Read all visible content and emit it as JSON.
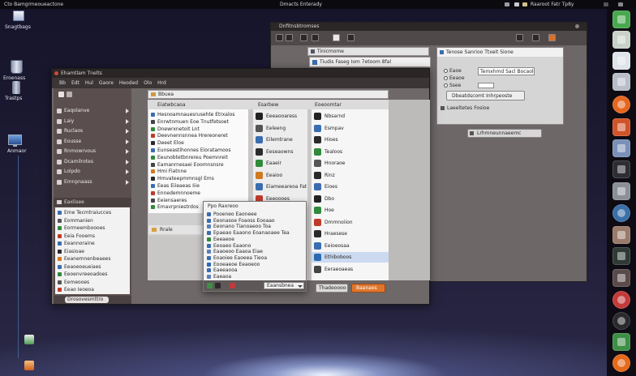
{
  "top_panel": {
    "left_title": "Cto Bamgrmeoueactone",
    "center_title": "Dmacts Enterady",
    "status_text": "Raaroot Fatr Tp8y"
  },
  "desktop": {
    "icons": [
      {
        "label": "Snagtbags",
        "icon": "document-stack-icon"
      },
      {
        "label": "Eroenass",
        "icon": "trash-icon"
      },
      {
        "label": "Trastps",
        "icon": "bin-icon"
      },
      {
        "label": "Anmaor",
        "icon": "monitor-icon"
      }
    ]
  },
  "dock": {
    "items": [
      {
        "icon": "chat-icon",
        "color": "#48a84e",
        "shape": "square"
      },
      {
        "icon": "phone-icon",
        "color": "#c9d2c8",
        "shape": "square"
      },
      {
        "icon": "grid-icon",
        "color": "#dfe4ea",
        "shape": "square"
      },
      {
        "icon": "document-icon",
        "color": "#b8bec8",
        "shape": "square"
      },
      {
        "icon": "media-player-icon",
        "color": "#e4661f",
        "shape": "round"
      },
      {
        "icon": "app-icon",
        "color": "#d0542a",
        "shape": "square"
      },
      {
        "icon": "image-icon",
        "color": "#7a90b8",
        "shape": "square"
      },
      {
        "icon": "terminal-icon",
        "color": "#2d2d33",
        "shape": "square"
      },
      {
        "icon": "photo-icon",
        "color": "#8a8f98",
        "shape": "square"
      },
      {
        "icon": "globe-icon",
        "color": "#3b6fa8",
        "shape": "round"
      },
      {
        "icon": "picture-icon",
        "color": "#9a7a6a",
        "shape": "square"
      },
      {
        "icon": "monitor-icon",
        "color": "#2f3a36",
        "shape": "square"
      },
      {
        "icon": "flag-icon",
        "color": "#5a4a4a",
        "shape": "square"
      },
      {
        "icon": "close-app-icon",
        "color": "#c23a3a",
        "shape": "round"
      },
      {
        "icon": "clock-icon",
        "color": "#2a2a2e",
        "shape": "round"
      },
      {
        "icon": "download-icon",
        "color": "#3e8f46",
        "shape": "square"
      },
      {
        "icon": "browser-icon",
        "color": "#e46a1a",
        "shape": "round"
      }
    ]
  },
  "back_window": {
    "title": "Dnfitnsbtromses",
    "bar_top": "Tinicmome",
    "bar_field": "Tiudis Faseg Iom 7etoom 8fal",
    "dialog": {
      "title": "Tenose Sanrioo Ttxeit Sione",
      "options": [
        "Eaoe",
        "Eeaoe",
        "Ssee"
      ],
      "text_value": "Temxhmd Sacl Bocaolet",
      "action_button": "Dbeatdscomt Inhrpeoste",
      "footer_text": "Laeeltetes Fosioe"
    },
    "bottom_button": "Lrhmneunnaeemc",
    "accent_color": "#e0762c"
  },
  "file_manager": {
    "title": "Ehamtlam Tnelts",
    "menu": [
      "Bb",
      "Edt",
      "Hul",
      "Gaore",
      "Heoded",
      "Olo",
      "Hrd"
    ],
    "sidebar": {
      "places": [
        {
          "label": "Eaqolanve",
          "icon": "folder-icon"
        },
        {
          "label": "Laiy",
          "icon": "folder-icon"
        },
        {
          "label": "Ruclaos",
          "icon": "folder-icon"
        },
        {
          "label": "Eousse",
          "icon": "folder-icon"
        },
        {
          "label": "Rnmowrvous",
          "icon": "folder-icon"
        },
        {
          "label": "Dcamilrotes",
          "icon": "folder-icon"
        },
        {
          "label": "Lolpdo",
          "icon": "folder-icon"
        },
        {
          "label": "Emnpnaass",
          "icon": "folder-icon"
        }
      ],
      "section": "Eaxlisee",
      "list": [
        {
          "label": "Eme Tecmtraiucces",
          "icon": "file-icon",
          "color": "#3a6db0"
        },
        {
          "label": "Eommanien",
          "icon": "file-icon",
          "color": "#555555"
        },
        {
          "label": "Eormeemboooes",
          "icon": "file-icon",
          "color": "#2f8a3a"
        },
        {
          "label": "Eeia Fooems",
          "icon": "file-icon",
          "color": "#c03a2a"
        },
        {
          "label": "Eeannoraine",
          "icon": "file-icon",
          "color": "#3a6db0"
        },
        {
          "label": "Eiasioae",
          "icon": "file-icon",
          "color": "#2a2a2a"
        },
        {
          "label": "Eeanemnenbeaees",
          "icon": "file-icon",
          "color": "#d07a20"
        },
        {
          "label": "Eeaoeoeueiaes",
          "icon": "file-icon",
          "color": "#3a6db0"
        },
        {
          "label": "Eeoenvreeoadoes",
          "icon": "file-icon",
          "color": "#2f8a3a"
        },
        {
          "label": "Eemeooes",
          "icon": "file-icon",
          "color": "#555555"
        },
        {
          "label": "Eeao Ieoeoa",
          "icon": "file-icon",
          "color": "#c03a2a"
        }
      ],
      "status": "Drosovesmttro"
    },
    "location": "Bbuea",
    "columns": [
      {
        "header": "Eiatwbcaoa",
        "items": [
          {
            "label": "Hesnoamnauesrusehte Etrxalos",
            "icon": "file-icon",
            "color": "#3a6db0"
          },
          {
            "label": "Enrwtnmuen Eoe Tnutfetsoet",
            "icon": "file-icon",
            "color": "#444444"
          },
          {
            "label": "Dnewrxnetoit Lnt",
            "icon": "file-icon",
            "color": "#2f8a3a"
          },
          {
            "label": "Deevnennsnnea Hrereoneret",
            "icon": "file-icon",
            "color": "#c03a2a"
          },
          {
            "label": "Deeet Eloe",
            "icon": "file-icon",
            "color": "#2a2a2a"
          },
          {
            "label": "Eunseastihonnes Eioratamoos",
            "icon": "file-icon",
            "color": "#3a6db0"
          },
          {
            "label": "Eeunobtetbnrereu Poemnreit",
            "icon": "file-icon",
            "color": "#2f8a3a"
          },
          {
            "label": "Eamanrnesaei Eoomnsnsre",
            "icon": "file-icon",
            "color": "#444444"
          },
          {
            "label": "Hmi Fiatnne",
            "icon": "file-icon",
            "color": "#d07a20"
          },
          {
            "label": "Hmvateepmmnsgl Ems",
            "icon": "file-icon",
            "color": "#2a2a2a"
          },
          {
            "label": "Eeas Eiieaeas Iiie",
            "icon": "file-icon",
            "color": "#3a6db0"
          },
          {
            "label": "Ennedemnnoeme",
            "icon": "file-icon",
            "color": "#c03a2a"
          },
          {
            "label": "Eeiensaeres",
            "icon": "file-icon",
            "color": "#444444"
          },
          {
            "label": "Emavrpniestrdos",
            "icon": "file-icon",
            "color": "#2f8a3a"
          }
        ]
      },
      {
        "header": "Esarbew",
        "items": [
          {
            "label": "Eeeaooaress",
            "icon": "app-icon",
            "color": "#222222"
          },
          {
            "label": "Eeleeng",
            "icon": "app-icon",
            "color": "#555555"
          },
          {
            "label": "Eilemtrane",
            "icon": "app-icon",
            "color": "#3a6db0"
          },
          {
            "label": "Eeseaowns",
            "icon": "app-icon",
            "color": "#2a2a2a"
          },
          {
            "label": "Eaaeir",
            "icon": "app-icon",
            "color": "#2f8a3a"
          },
          {
            "label": "Eeaioo",
            "icon": "app-icon",
            "color": "#d07a20"
          },
          {
            "label": "Eiameeareoa Fat",
            "icon": "app-icon",
            "color": "#3a6db0"
          },
          {
            "label": "Eeeoooes",
            "icon": "app-icon",
            "color": "#c03a2a"
          }
        ]
      },
      {
        "header": "Eoeoomtar",
        "selected_index": 12,
        "items": [
          {
            "label": "Nbsarnd",
            "icon": "app-icon",
            "color": "#222222"
          },
          {
            "label": "Esmpav",
            "icon": "app-icon",
            "color": "#3a6db0"
          },
          {
            "label": "Hioes",
            "icon": "app-icon",
            "color": "#2a2a2a"
          },
          {
            "label": "Tealoos",
            "icon": "app-icon",
            "color": "#2f8a3a"
          },
          {
            "label": "Hnoraoe",
            "icon": "app-icon",
            "color": "#555555"
          },
          {
            "label": "Rinz",
            "icon": "app-icon",
            "color": "#2a2a2a"
          },
          {
            "label": "Eioes",
            "icon": "app-icon",
            "color": "#3a6db0"
          },
          {
            "label": "Dbo",
            "icon": "app-icon",
            "color": "#222222"
          },
          {
            "label": "Hoe",
            "icon": "app-icon",
            "color": "#2f8a3a"
          },
          {
            "label": "Dmmnoiion",
            "icon": "app-icon",
            "color": "#c03a2a"
          },
          {
            "label": "Hraesese",
            "icon": "app-icon",
            "color": "#2a2a2a"
          },
          {
            "label": "Eeioeosaa",
            "icon": "app-icon",
            "color": "#3a6db0"
          },
          {
            "label": "Ethiboboos",
            "icon": "app-icon",
            "color": "#2a6ab0"
          },
          {
            "label": "Eeraeoaeas",
            "icon": "app-icon",
            "color": "#444444"
          }
        ]
      }
    ],
    "footer_item": "Rrale",
    "buttons": {
      "secondary": "Thadeooooes",
      "primary": "Baanaes"
    },
    "accent_color": "#e0762c",
    "selection_color": "#cbdaf0"
  },
  "popup": {
    "title": "Ppo Raxreoo",
    "items": [
      {
        "label": "Pooeneo Eaoneee",
        "icon": "item-icon",
        "color": "#3a6db0"
      },
      {
        "label": "Eeonasoe Foaoss Eooaao",
        "icon": "item-icon",
        "color": "#3a6db0"
      },
      {
        "label": "Eeonano Tianoaeoo Toa",
        "icon": "item-icon",
        "color": "#5a7fb8"
      },
      {
        "label": "Epaeao Eaaono Eoanaoaee Tea",
        "icon": "item-icon",
        "color": "#3a6db0"
      },
      {
        "label": "Eeeaeoe",
        "icon": "item-icon",
        "color": "#2f8a3a"
      },
      {
        "label": "Eeoaeo Eaaono",
        "icon": "item-icon",
        "color": "#3a6db0"
      },
      {
        "label": "Eaaoeoo Eaaoa Eiae",
        "icon": "item-icon",
        "color": "#5a7fb8"
      },
      {
        "label": "Eoaoiee Eaoeea Tieoa",
        "icon": "item-icon",
        "color": "#3a6db0"
      },
      {
        "label": "Eooeaeoe Eeaoeoo",
        "icon": "item-icon",
        "color": "#2a6ab0"
      },
      {
        "label": "Eaeeaooa",
        "icon": "item-icon",
        "color": "#3a6db0"
      },
      {
        "label": "Eaeaoa",
        "icon": "item-icon",
        "color": "#5a7fb8"
      }
    ],
    "dropdown": "Eaansbnea"
  }
}
